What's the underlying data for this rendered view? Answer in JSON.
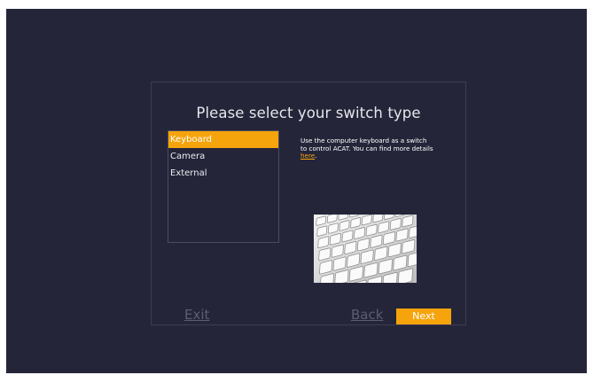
{
  "dialog": {
    "title": "Please select your switch type"
  },
  "switch_list": {
    "items": [
      {
        "label": "Keyboard",
        "selected": true
      },
      {
        "label": "Camera",
        "selected": false
      },
      {
        "label": "External",
        "selected": false
      }
    ]
  },
  "description": {
    "text": "Use the computer keyboard as a switch to control ACAT. You can find more details ",
    "link_text": "here",
    "suffix": "."
  },
  "preview_image": {
    "icon": "keyboard-photo"
  },
  "buttons": {
    "exit_label": "Exit",
    "back_label": "Back",
    "next_label": "Next"
  },
  "colors": {
    "background": "#25253a",
    "accent": "#f5a40c",
    "text": "#e6e6ec",
    "muted": "#5d5d72"
  }
}
